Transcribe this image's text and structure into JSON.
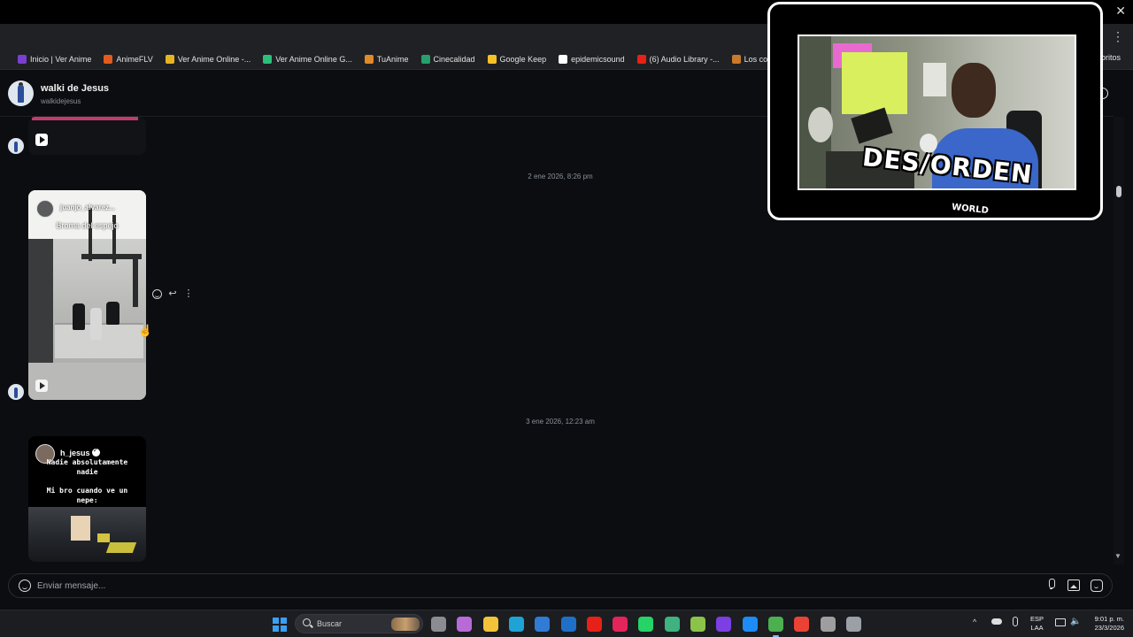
{
  "browser": {
    "bookmarks": [
      {
        "label": "Inicio | Ver Anime",
        "color": "#7a3fd1"
      },
      {
        "label": "AnimeFLV",
        "color": "#e25c1e"
      },
      {
        "label": "Ver Anime Online -...",
        "color": "#e6b422"
      },
      {
        "label": "Ver Anime Online G...",
        "color": "#2dbf7a"
      },
      {
        "label": "TuAnime",
        "color": "#e08a2a"
      },
      {
        "label": "Cinecalidad",
        "color": "#27a06b"
      },
      {
        "label": "Google Keep",
        "color": "#f6c026"
      },
      {
        "label": "epidemicsound",
        "color": "#ffffff"
      },
      {
        "label": "(6) Audio Library -...",
        "color": "#e62117"
      },
      {
        "label": "Los colores y sus co...",
        "color": "#c97a2a"
      }
    ],
    "bookmarks_overflow": "voritos"
  },
  "chat": {
    "name": "walki de Jesus",
    "handle": "walkidejesus",
    "timestamps": [
      "2 ene 2026, 8:26 pm",
      "3 ene 2026, 12:23 am"
    ],
    "post2": {
      "user": "juanjo_alvarez...",
      "caption": "Broma del espejo"
    },
    "post3": {
      "user": "h_jesus",
      "meme_line1": "Nadie absolutamente nadie",
      "meme_line2": "Mi bro cuando ve un nepe:"
    }
  },
  "composer": {
    "placeholder": "Enviar mensaje..."
  },
  "taskbar": {
    "search_label": "Buscar",
    "apps": [
      {
        "name": "task-view",
        "color": "#8a8c91"
      },
      {
        "name": "copilot",
        "color": "#b86bd8"
      },
      {
        "name": "file-explorer",
        "color": "#f3c33a"
      },
      {
        "name": "edge",
        "color": "#1fa3d6"
      },
      {
        "name": "store",
        "color": "#2f7bd6"
      },
      {
        "name": "outlook",
        "color": "#1f6fc8"
      },
      {
        "name": "youtube",
        "color": "#e62117"
      },
      {
        "name": "tiktok",
        "color": "#e4245a"
      },
      {
        "name": "whatsapp",
        "color": "#25d366"
      },
      {
        "name": "edge-dev",
        "color": "#3fb27f"
      },
      {
        "name": "visual-studio-code",
        "color": "#8bc34a"
      },
      {
        "name": "visual-studio",
        "color": "#7b3fe4"
      },
      {
        "name": "capcut",
        "color": "#1d8cf8"
      },
      {
        "name": "chrome",
        "color": "#4caf50"
      },
      {
        "name": "chrome-alt",
        "color": "#ea4335"
      },
      {
        "name": "chrome-canary",
        "color": "#9e9e9e"
      },
      {
        "name": "settings",
        "color": "#9aa0a6"
      }
    ],
    "language": [
      "ESP",
      "LAA"
    ],
    "time": "9:01 p. m.",
    "date": "23/3/2026"
  },
  "webcam": {
    "logo_main": "DES/ORDEN",
    "logo_sub": "WORLD"
  }
}
